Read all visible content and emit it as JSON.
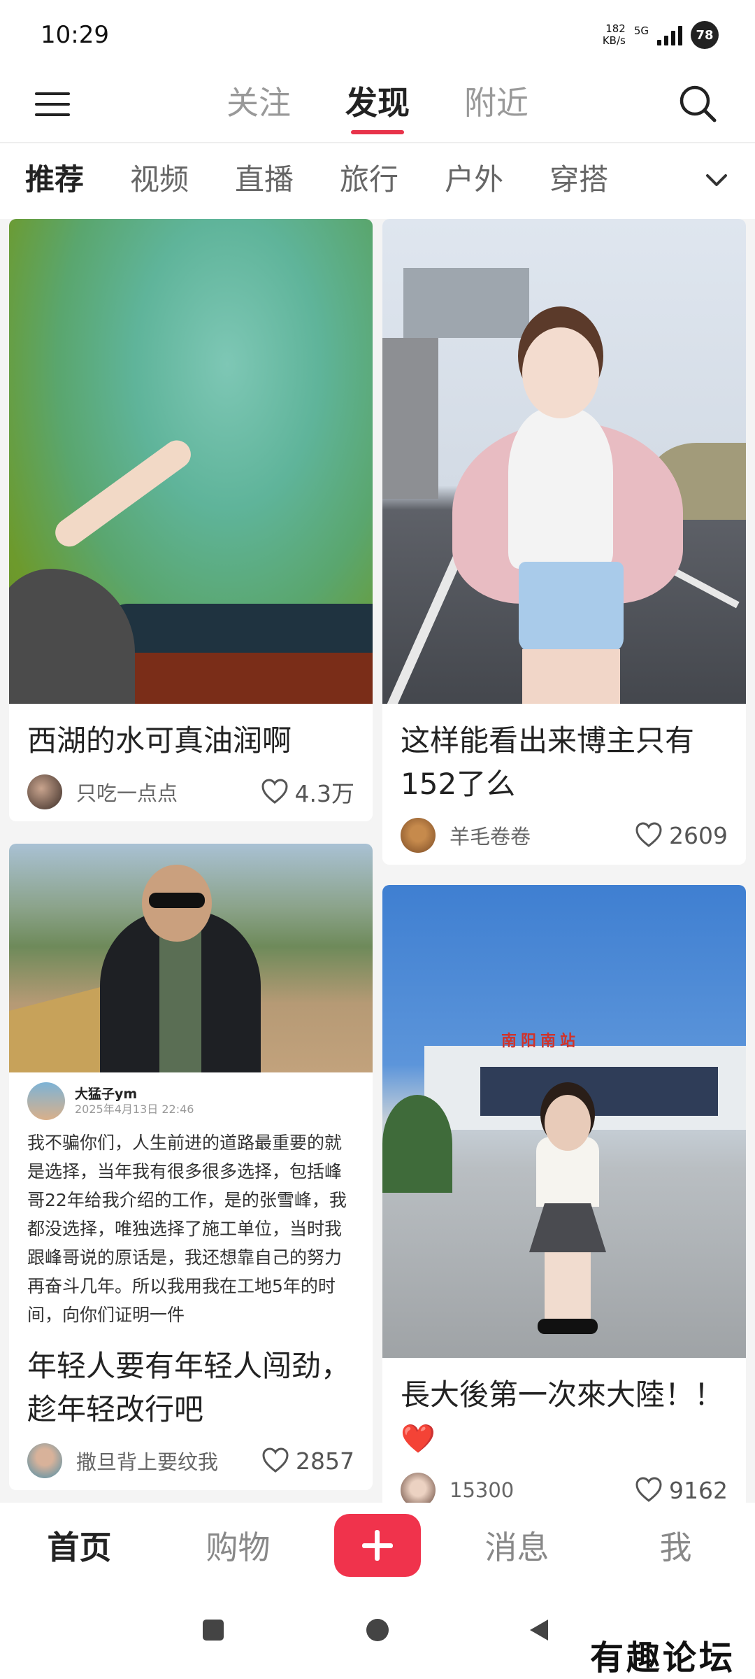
{
  "status_bar": {
    "time": "10:29",
    "net_speed_value": "182",
    "net_speed_unit": "KB/s",
    "network_type": "5G",
    "battery": "78"
  },
  "top_nav": {
    "tabs": [
      {
        "label": "关注",
        "active": false
      },
      {
        "label": "发现",
        "active": true
      },
      {
        "label": "附近",
        "active": false
      }
    ],
    "menu_icon": "menu-icon",
    "search_icon": "search-icon"
  },
  "categories": {
    "items": [
      "推荐",
      "视频",
      "直播",
      "旅行",
      "户外",
      "穿搭"
    ],
    "active": "推荐",
    "more_icon": "chevron-down-icon"
  },
  "feed": {
    "cards": [
      {
        "title": "西湖的水可真油润啊",
        "author": "只吃一点点",
        "likes": "4.3万"
      },
      {
        "title": "这样能看出来博主只有152了么",
        "author": "羊毛卷卷",
        "likes": "2609"
      },
      {
        "post_user": "大猛子ym",
        "post_time": "2025年4月13日 22:46",
        "post_body": "我不骗你们，人生前进的道路最重要的就是选择，当年我有很多很多选择，包括峰哥22年给我介绍的工作，是的张雪峰，我都没选择，唯独选择了施工单位，当时我跟峰哥说的原话是，我还想靠自己的努力再奋斗几年。所以我用我在工地5年的时间，向你们证明一件",
        "title": "年轻人要有年轻人闯劲，趁年轻改行吧",
        "author": "撒旦背上要纹我",
        "likes": "2857"
      },
      {
        "image_sign": "南阳南站",
        "title": "長大後第一次來大陸！！",
        "title_emoji": "❤️",
        "author": "15300",
        "likes": "9162"
      }
    ]
  },
  "bottom_tabs": {
    "home": "首页",
    "shop": "购物",
    "messages": "消息",
    "me": "我",
    "post_icon": "plus-icon"
  },
  "watermark": "有趣论坛",
  "colors": {
    "accent": "#e8334a",
    "post_button": "#f0334c"
  }
}
